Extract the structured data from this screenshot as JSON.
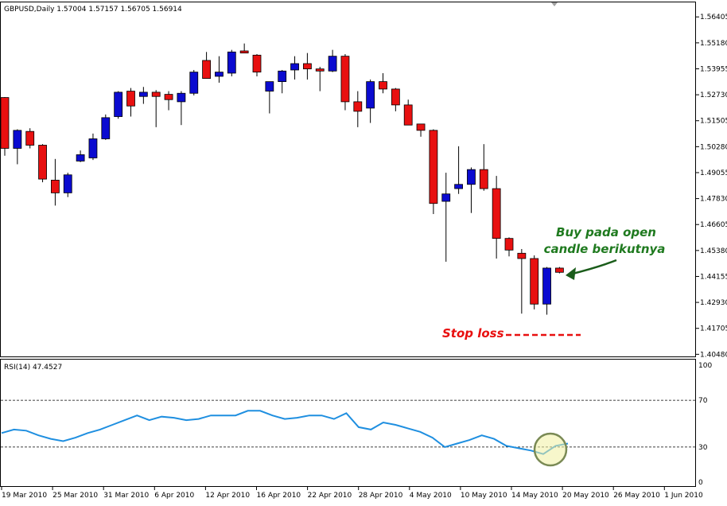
{
  "chart_data": [
    {
      "type": "candlestick",
      "title": "GBPUSD,Daily  1.57004 1.57157 1.56705 1.56914",
      "symbol_timeframe": "GBPUSD,Daily",
      "ohlc_header": "1.57004 1.57157 1.56705 1.56914",
      "up_color": "#0b0bd0",
      "down_color": "#e81010",
      "ylim": [
        1.4038,
        1.5709
      ],
      "y_ticks": [
        "1.56405",
        "1.55180",
        "1.53955",
        "1.52730",
        "1.51505",
        "1.50280",
        "1.49055",
        "1.47830",
        "1.46605",
        "1.45380",
        "1.44155",
        "1.42930",
        "1.41705",
        "1.40480"
      ],
      "x_ticks": [
        "19 Mar 2010",
        "25 Mar 2010",
        "31 Mar 2010",
        "6 Apr 2010",
        "12 Apr 2010",
        "16 Apr 2010",
        "22 Apr 2010",
        "28 Apr 2010",
        "4 May 2010",
        "10 May 2010",
        "14 May 2010",
        "20 May 2010",
        "26 May 2010",
        "1 Jun 2010"
      ],
      "candles": [
        {
          "o": 1.526,
          "h": 1.5262,
          "l": 1.4985,
          "c": 1.502
        },
        {
          "o": 1.502,
          "h": 1.511,
          "l": 1.4945,
          "c": 1.5105
        },
        {
          "o": 1.51,
          "h": 1.5115,
          "l": 1.502,
          "c": 1.5035
        },
        {
          "o": 1.5035,
          "h": 1.504,
          "l": 1.486,
          "c": 1.4875
        },
        {
          "o": 1.487,
          "h": 1.497,
          "l": 1.475,
          "c": 1.481
        },
        {
          "o": 1.481,
          "h": 1.4905,
          "l": 1.479,
          "c": 1.4895
        },
        {
          "o": 1.496,
          "h": 1.501,
          "l": 1.4955,
          "c": 1.499
        },
        {
          "o": 1.4975,
          "h": 1.509,
          "l": 1.4965,
          "c": 1.5065
        },
        {
          "o": 1.5065,
          "h": 1.518,
          "l": 1.506,
          "c": 1.5165
        },
        {
          "o": 1.517,
          "h": 1.529,
          "l": 1.516,
          "c": 1.5285
        },
        {
          "o": 1.529,
          "h": 1.5305,
          "l": 1.517,
          "c": 1.522
        },
        {
          "o": 1.5265,
          "h": 1.531,
          "l": 1.523,
          "c": 1.5285
        },
        {
          "o": 1.5285,
          "h": 1.5295,
          "l": 1.512,
          "c": 1.5265
        },
        {
          "o": 1.5275,
          "h": 1.529,
          "l": 1.52,
          "c": 1.525
        },
        {
          "o": 1.524,
          "h": 1.529,
          "l": 1.513,
          "c": 1.528
        },
        {
          "o": 1.528,
          "h": 1.539,
          "l": 1.527,
          "c": 1.538
        },
        {
          "o": 1.5435,
          "h": 1.5475,
          "l": 1.535,
          "c": 1.535
        },
        {
          "o": 1.536,
          "h": 1.5455,
          "l": 1.533,
          "c": 1.538
        },
        {
          "o": 1.5375,
          "h": 1.5485,
          "l": 1.536,
          "c": 1.5475
        },
        {
          "o": 1.548,
          "h": 1.5515,
          "l": 1.548,
          "c": 1.547
        },
        {
          "o": 1.546,
          "h": 1.5465,
          "l": 1.536,
          "c": 1.538
        },
        {
          "o": 1.529,
          "h": 1.5335,
          "l": 1.5185,
          "c": 1.5335
        },
        {
          "o": 1.5335,
          "h": 1.539,
          "l": 1.528,
          "c": 1.5385
        },
        {
          "o": 1.539,
          "h": 1.5455,
          "l": 1.5345,
          "c": 1.542
        },
        {
          "o": 1.542,
          "h": 1.547,
          "l": 1.5345,
          "c": 1.5395
        },
        {
          "o": 1.5395,
          "h": 1.5405,
          "l": 1.529,
          "c": 1.5385
        },
        {
          "o": 1.5385,
          "h": 1.5485,
          "l": 1.538,
          "c": 1.5455
        },
        {
          "o": 1.5455,
          "h": 1.5465,
          "l": 1.52,
          "c": 1.524
        },
        {
          "o": 1.524,
          "h": 1.529,
          "l": 1.512,
          "c": 1.5195
        },
        {
          "o": 1.521,
          "h": 1.5345,
          "l": 1.514,
          "c": 1.5335
        },
        {
          "o": 1.5335,
          "h": 1.5375,
          "l": 1.528,
          "c": 1.53
        },
        {
          "o": 1.53,
          "h": 1.5305,
          "l": 1.5195,
          "c": 1.5225
        },
        {
          "o": 1.5225,
          "h": 1.525,
          "l": 1.513,
          "c": 1.513
        },
        {
          "o": 1.5135,
          "h": 1.5135,
          "l": 1.5075,
          "c": 1.5105
        },
        {
          "o": 1.5105,
          "h": 1.511,
          "l": 1.471,
          "c": 1.476
        },
        {
          "o": 1.477,
          "h": 1.4905,
          "l": 1.4485,
          "c": 1.4805
        },
        {
          "o": 1.483,
          "h": 1.503,
          "l": 1.4805,
          "c": 1.485
        },
        {
          "o": 1.485,
          "h": 1.493,
          "l": 1.4715,
          "c": 1.492
        },
        {
          "o": 1.492,
          "h": 1.504,
          "l": 1.482,
          "c": 1.483
        },
        {
          "o": 1.483,
          "h": 1.489,
          "l": 1.45,
          "c": 1.4595
        },
        {
          "o": 1.4595,
          "h": 1.46,
          "l": 1.451,
          "c": 1.454
        },
        {
          "o": 1.4525,
          "h": 1.4545,
          "l": 1.424,
          "c": 1.45
        },
        {
          "o": 1.45,
          "h": 1.4515,
          "l": 1.426,
          "c": 1.4285
        },
        {
          "o": 1.4285,
          "h": 1.446,
          "l": 1.4235,
          "c": 1.4455
        },
        {
          "o": 1.4455,
          "h": 1.446,
          "l": 1.443,
          "c": 1.4435
        }
      ]
    },
    {
      "type": "line",
      "title": "RSI(14) 47.4527",
      "ylim": [
        0,
        100
      ],
      "y_ticks": [
        "100",
        "70",
        "30",
        "0"
      ],
      "levels": [
        70,
        30
      ],
      "line_color": "#1f8fe0",
      "series": [
        {
          "values": [
            42,
            45,
            44,
            40,
            37,
            35,
            38,
            42,
            45,
            49,
            53,
            57,
            53,
            56,
            55,
            53,
            54,
            57,
            57,
            57,
            61,
            61,
            57,
            54,
            55,
            57,
            57,
            54,
            59,
            47,
            45,
            51,
            49,
            46,
            43,
            38,
            30,
            33,
            36,
            40,
            37,
            31,
            29,
            27,
            24,
            31,
            33
          ]
        }
      ]
    }
  ],
  "annotations": {
    "buy_line1": "Buy pada open",
    "buy_line2": "candle berikutnya",
    "stop_loss": "Stop loss"
  }
}
